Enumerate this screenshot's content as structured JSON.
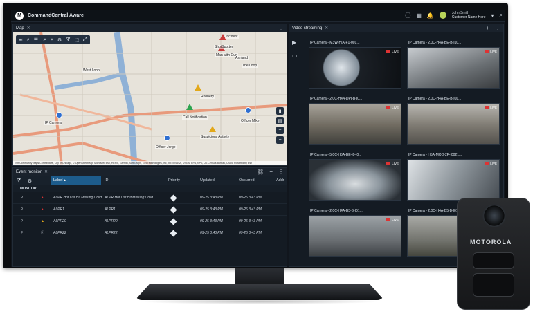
{
  "app": {
    "title": "CommandCentral Aware",
    "user_name": "John Smith",
    "user_org": "Customer Name Here"
  },
  "map_panel": {
    "tab_label": "Map",
    "labels": [
      "Incident",
      "ShotSpotter",
      "Man with Gun",
      "Ashland",
      "The Loop",
      "West Loop",
      "Robbery",
      "IP Camera",
      "Call Notification",
      "Officer Mike",
      "Suspicious Activity",
      "Officer Jorge"
    ],
    "attribution": "Esri Community Maps Contributors, City of Chicago, © OpenStreetMap, Microsoft, Esri, HERE, Garmin, SafeGraph, GeoTechnologies, Inc, METI/NASA, USGS, EPA, NPS, US Census Bureau, USDA   Powered by Esri"
  },
  "event_monitor": {
    "tab_label": "Event monitor",
    "columns": {
      "label": "Label",
      "id": "ID",
      "priority": "Priority",
      "updated": "Updated",
      "occurred": "Occurred",
      "extra": "Addr"
    },
    "group_label": "MONITOR",
    "rows": [
      {
        "label": "ALPR Hot List Hit Missing Child",
        "id": "ALPR Hot List Hit Missing Child",
        "priority": "1",
        "updated": "09-25 3:43 PM",
        "occurred": "09-25 3:43 PM"
      },
      {
        "label": "ALPR1",
        "id": "ALPR1",
        "priority": "1",
        "updated": "09-25 3:43 PM",
        "occurred": "09-25 3:43 PM"
      },
      {
        "label": "ALPR20",
        "id": "ALPR20",
        "priority": "1",
        "updated": "09-25 3:43 PM",
        "occurred": "09-25 3:43 PM"
      },
      {
        "label": "ALPR22",
        "id": "ALPR22",
        "priority": "1",
        "updated": "09-25 3:43 PM",
        "occurred": "09-25 3:43 PM"
      }
    ]
  },
  "video_panel": {
    "tab_label": "Video streaming",
    "live_label": "LIVE",
    "cameras": [
      {
        "title": "IP Camera - M3W-HIA-F1-001..."
      },
      {
        "title": "IP Camera - 2.0C-H4A-BE-B-I10..."
      },
      {
        "title": "IP Camera - 2.0C-H4A-DPI-B-I0..."
      },
      {
        "title": "IP Camera - 2.0C-H4A-BE-B-I0L..."
      },
      {
        "title": "IP Camera - 5.0C-H5A-BE-I0-I0..."
      },
      {
        "title": "IP Camera - H5A-MOD-2F-I0021..."
      },
      {
        "title": "IP Camera - 2.0C-H4A-B3-B-I01..."
      },
      {
        "title": "IP Camera - 2.0C-H4A-B5-B-I01..."
      }
    ]
  },
  "bodycam": {
    "brand": "MOTOROLA"
  },
  "colors": {
    "accent": "#1d5c8c",
    "live": "#dd3333",
    "user_avatar": "#b7d35a"
  }
}
